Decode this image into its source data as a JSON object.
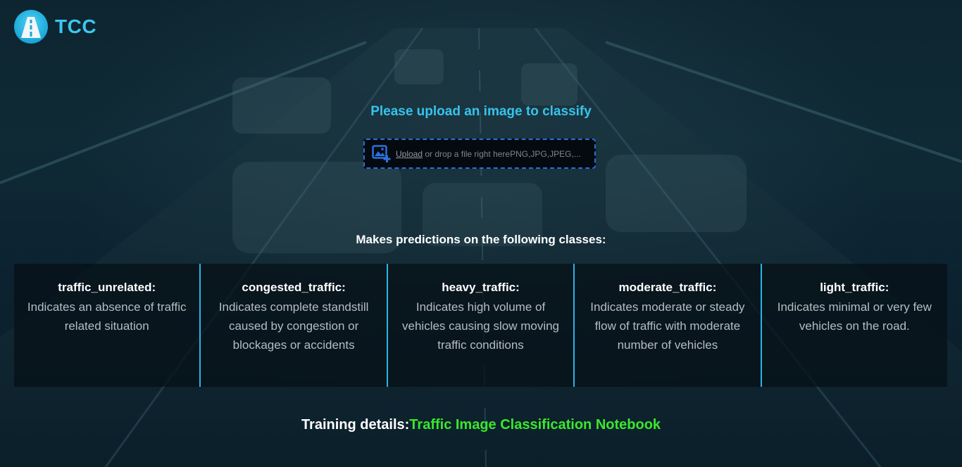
{
  "brand": {
    "name": "TCC"
  },
  "upload": {
    "title": "Please upload an image to classify",
    "link_text": "Upload",
    "hint_text": " or drop a file right herePNG,JPG,JPEG,..."
  },
  "classes": {
    "title": "Makes predictions on the following classes:",
    "items": [
      {
        "name": "traffic_unrelated:",
        "description": "Indicates an absence of traffic related situation"
      },
      {
        "name": "congested_traffic:",
        "description": "Indicates complete standstill caused by congestion or blockages or accidents"
      },
      {
        "name": "heavy_traffic:",
        "description": "Indicates high volume of vehicles causing slow moving traffic conditions"
      },
      {
        "name": "moderate_traffic:",
        "description": "Indicates moderate or steady flow of traffic with moderate number of vehicles"
      },
      {
        "name": "light_traffic:",
        "description": "Indicates minimal or very few vehicles on the road."
      }
    ]
  },
  "training": {
    "label": "Training details:",
    "link_text": "Traffic Image Classification Notebook"
  },
  "colors": {
    "accent": "#37c3ec",
    "divider": "#2ab4e8",
    "link_green": "#39e82c",
    "dropzone_border": "#2a6fd6"
  },
  "icons": {
    "logo": "road-icon",
    "upload": "add-image-icon"
  }
}
